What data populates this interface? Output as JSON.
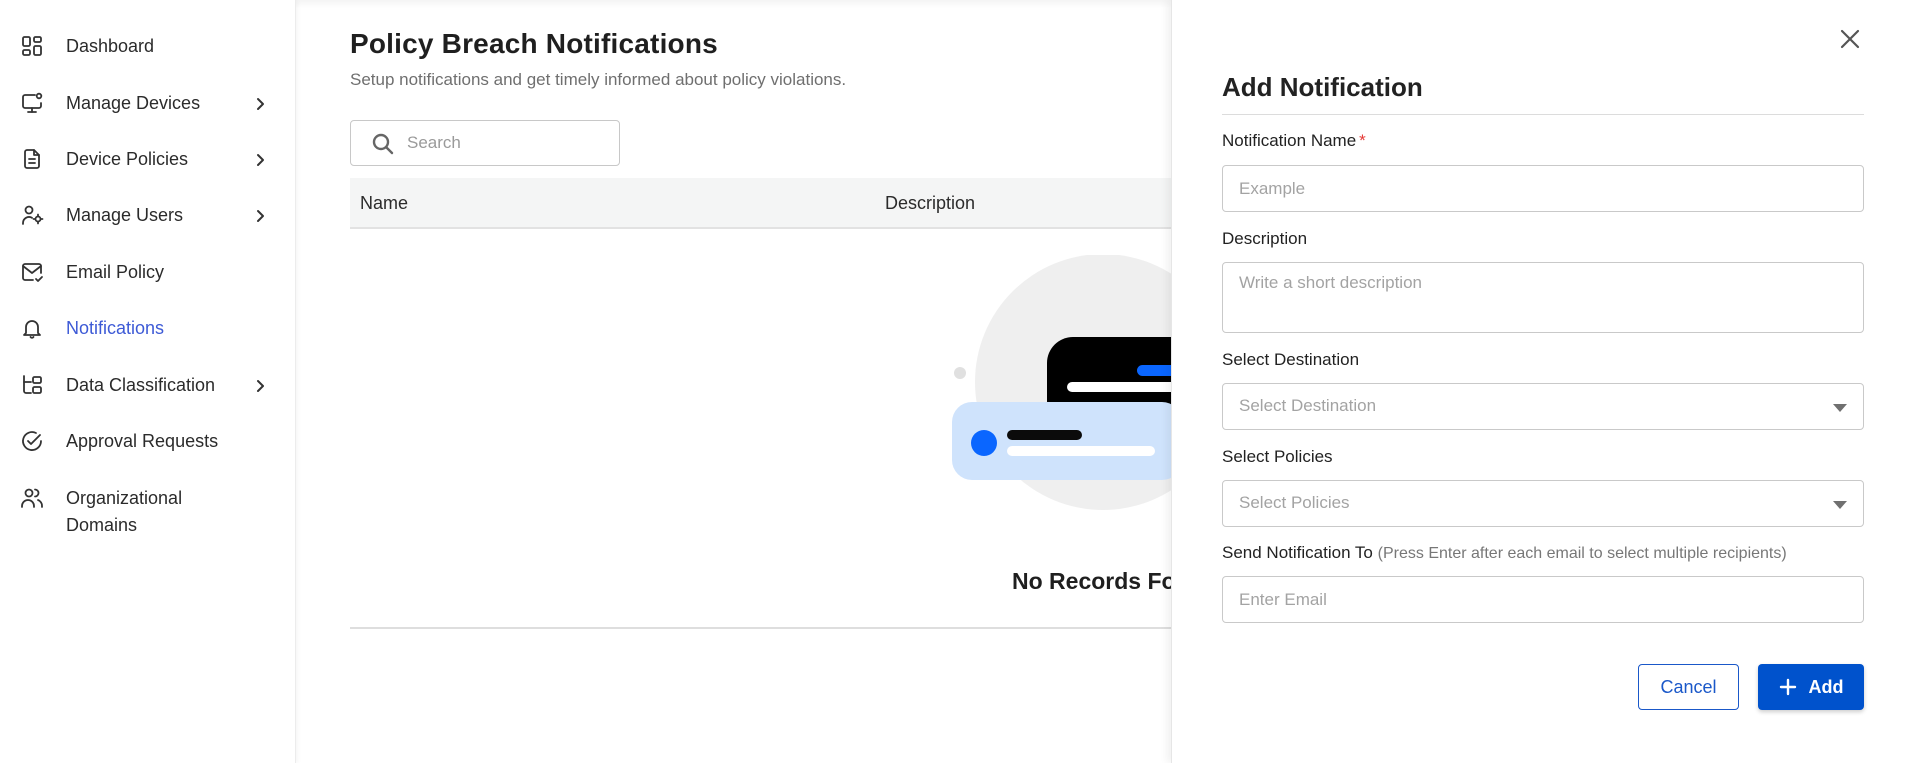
{
  "sidebar": {
    "items": [
      {
        "label": "Dashboard",
        "icon": "dashboard-grid-icon",
        "has_submenu": false,
        "active": false
      },
      {
        "label": "Manage Devices",
        "icon": "monitor-icon",
        "has_submenu": true,
        "active": false
      },
      {
        "label": "Device Policies",
        "icon": "policy-document-icon",
        "has_submenu": true,
        "active": false
      },
      {
        "label": "Manage Users",
        "icon": "user-settings-icon",
        "has_submenu": true,
        "active": false
      },
      {
        "label": "Email Policy",
        "icon": "mail-check-icon",
        "has_submenu": false,
        "active": false
      },
      {
        "label": "Notifications",
        "icon": "bell-icon",
        "has_submenu": false,
        "active": true
      },
      {
        "label": "Data Classification",
        "icon": "folder-tree-icon",
        "has_submenu": true,
        "active": false
      },
      {
        "label": "Approval Requests",
        "icon": "check-circle-icon",
        "has_submenu": false,
        "active": false
      },
      {
        "label": "Organizational Domains",
        "icon": "users-icon",
        "has_submenu": false,
        "active": false
      }
    ],
    "active_color": "#3d5ad6"
  },
  "main": {
    "title": "Policy Breach Notifications",
    "subtitle": "Setup notifications and get timely informed about policy violations.",
    "search": {
      "placeholder": "Search",
      "value": ""
    },
    "table": {
      "columns": [
        "Name",
        "Description"
      ],
      "rows": [],
      "empty_text": "No Records Found"
    }
  },
  "drawer": {
    "title": "Add Notification",
    "fields": {
      "name": {
        "label": "Notification Name",
        "required_mark": "*",
        "placeholder": "Example",
        "value": ""
      },
      "description": {
        "label": "Description",
        "placeholder": "Write a short description",
        "value": ""
      },
      "destination": {
        "label": "Select Destination",
        "placeholder": "Select Destination",
        "value": ""
      },
      "policies": {
        "label": "Select Policies",
        "placeholder": "Select Policies",
        "value": ""
      },
      "recipients": {
        "label": "Send Notification To",
        "hint": "(Press Enter after each email to select multiple recipients)",
        "placeholder": "Enter Email",
        "value": ""
      }
    },
    "buttons": {
      "cancel": "Cancel",
      "add": "Add"
    },
    "colors": {
      "primary": "#0052cc",
      "required": "#e53935"
    }
  }
}
